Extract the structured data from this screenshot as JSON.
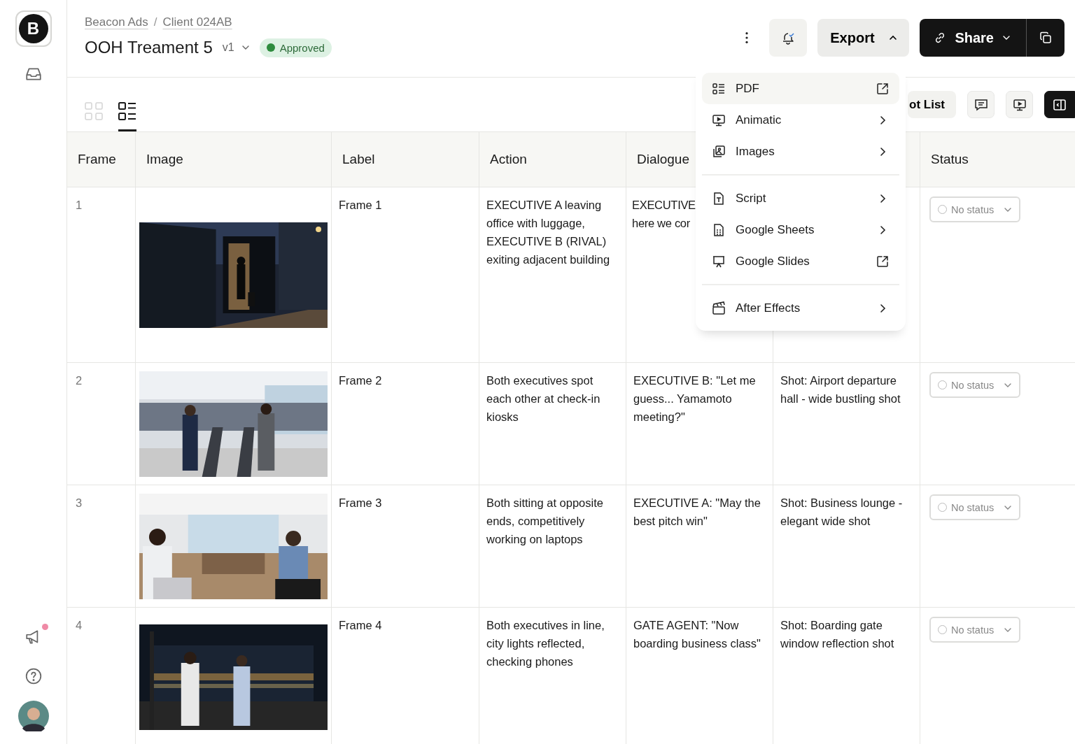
{
  "sidebar": {
    "logo": "B",
    "notification_dot": true
  },
  "breadcrumbs": [
    "Beacon Ads",
    "Client 024AB"
  ],
  "breadcrumb_separator": "/",
  "title": "OOH Treament 5",
  "version": "v1",
  "status_badge": {
    "label": "Approved",
    "color": "#2e8b3e"
  },
  "header_actions": {
    "export": {
      "label": "Export",
      "expanded": true
    },
    "share": {
      "label": "Share"
    }
  },
  "view_toggle": [
    {
      "kind": "grid",
      "selected": false
    },
    {
      "kind": "list",
      "selected": true
    }
  ],
  "toolbar": {
    "shot_list": "ot List",
    "tools": [
      {
        "kind": "comments",
        "on": false
      },
      {
        "kind": "present",
        "on": false
      },
      {
        "kind": "panel",
        "on": true
      }
    ]
  },
  "table": {
    "columns": [
      {
        "label": "Frame"
      },
      {
        "label": "Image"
      },
      {
        "label": "Label"
      },
      {
        "label": "Action"
      },
      {
        "label": "Dialogue"
      },
      {
        "label": "Status"
      }
    ],
    "rows": [
      {
        "frame": "1",
        "image": {
          "kind": "picture"
        },
        "label": "Frame 1",
        "action": "EXECUTIVE A leaving office with luggage, EXECUTIVE B (RIVAL) exiting adjacent building",
        "dialogue_lines": [
          "EXECUTIVE",
          "here we cor"
        ],
        "status": "No status"
      },
      {
        "frame": "2",
        "image": {
          "kind": "picture"
        },
        "label": "Frame 2",
        "action": "Both executives spot each other at check-in kiosks",
        "dialogue": "EXECUTIVE B: \"Let me guess... Yamamoto meeting?\"",
        "shot": "Shot: Airport departure hall - wide bustling shot",
        "status": "No status"
      },
      {
        "frame": "3",
        "image": {
          "kind": "picture"
        },
        "label": "Frame 3",
        "action": "Both sitting at opposite ends, competitively working on laptops",
        "dialogue": "EXECUTIVE A: \"May the best pitch win\"",
        "shot": "Shot: Business lounge - elegant wide shot",
        "status": "No status"
      },
      {
        "frame": "4",
        "image": {
          "kind": "picture"
        },
        "label": "Frame 4",
        "action": "Both executives in line, city lights reflected, checking phones",
        "dialogue": "GATE AGENT: \"Now boarding business class\"",
        "shot": "Shot: Boarding gate window reflection shot",
        "status": "No status"
      }
    ]
  },
  "export_menu": {
    "groups": [
      [
        {
          "label": "PDF",
          "has_submenu": false,
          "selected": true
        },
        {
          "label": "Animatic",
          "has_submenu": true,
          "selected": false
        },
        {
          "label": "Images",
          "has_submenu": true,
          "selected": false
        }
      ],
      [
        {
          "label": "Script",
          "has_submenu": true,
          "selected": false
        },
        {
          "label": "Google Sheets",
          "has_submenu": true,
          "selected": false
        },
        {
          "label": "Google Slides",
          "has_submenu": false,
          "selected": false
        }
      ],
      [
        {
          "label": "After Effects",
          "has_submenu": true,
          "selected": false
        }
      ]
    ]
  }
}
